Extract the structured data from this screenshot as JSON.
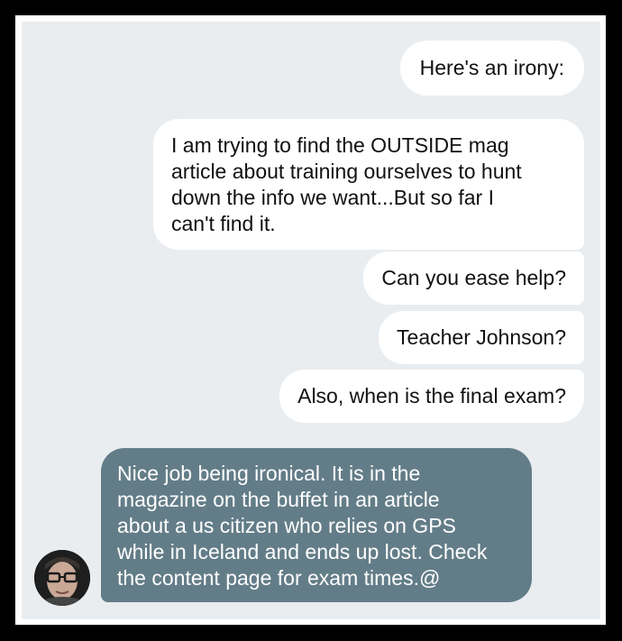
{
  "messages": [
    {
      "text": "Here's an irony:"
    },
    {
      "text": "I am trying to find the OUTSIDE mag\narticle about training ourselves to hunt\ndown the info we want...But so far I\ncan't find it."
    },
    {
      "text": "Can you ease help?"
    },
    {
      "text": "Teacher Johnson?"
    },
    {
      "text": "Also, when is the final exam?"
    }
  ],
  "reply": {
    "text": "Nice job being ironical. It is in the\nmagazine on the buffet in an article\nabout a us citizen who relies on GPS\nwhile in Iceland and ends up lost. Check\nthe content page for exam times.@"
  },
  "colors": {
    "chat_background": "#e9edf0",
    "outgoing_bubble": "#ffffff",
    "reply_bubble": "#637d88"
  },
  "icons": {
    "avatar": "user-avatar-photo"
  }
}
